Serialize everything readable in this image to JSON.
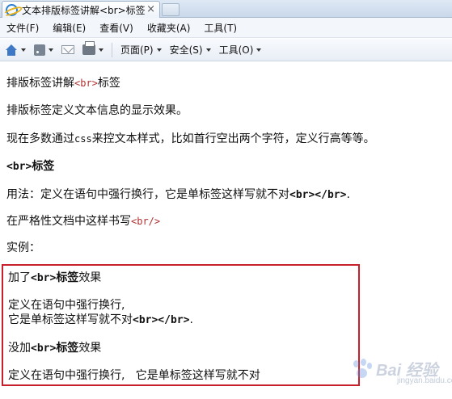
{
  "browser": {
    "tab_title": "文本排版标签讲解<br>标签",
    "tab_close": "×"
  },
  "menu": {
    "items": [
      "文件(F)",
      "编辑(E)",
      "查看(V)",
      "收藏夹(A)",
      "工具(T)"
    ]
  },
  "commandbar": {
    "page": "页面(P)",
    "safety": "安全(S)",
    "tools": "工具(O)"
  },
  "content": {
    "heading_prefix": "排版标签讲解",
    "heading_code": "<br>",
    "heading_suffix": "标签",
    "line1": "排版标签定义文本信息的显示效果。",
    "line2_prefix": "现在多数通过",
    "line2_code": "css",
    "line2_suffix": "来控文本样式，比如首行空出两个字符，定义行高等等。",
    "br_title_code": "<br>",
    "br_title_text": "标签",
    "usage_prefix": "用法：定义在语句中强行换行，它是单标签这样写就不对",
    "usage_code": "<br></br>",
    "usage_end": ".",
    "strict_prefix": "在严格性文档中这样书写",
    "strict_code": "<br/>",
    "example_label": "实例：",
    "ex_added_prefix": "加了",
    "ex_added_code": "<br>",
    "ex_added_bold": "标签",
    "ex_added_suffix": "效果",
    "ex_line_a": "定义在语句中强行换行,",
    "ex_line_b_prefix": "它是单标签这样写就不对",
    "ex_line_b_code": "<br></br>",
    "ex_line_b_end": ".",
    "ex_noadd_prefix": "没加",
    "ex_noadd_code": "<br>",
    "ex_noadd_bold": "标签",
    "ex_noadd_suffix": "效果",
    "ex_line_c": "定义在语句中强行换行,   它是单标签这样写就不对"
  },
  "watermark": {
    "brand": "Bai 经验",
    "sub": "jingyan.baidu.com"
  },
  "colors": {
    "highlight_box": "#c8202a",
    "code_red": "#b03030"
  }
}
